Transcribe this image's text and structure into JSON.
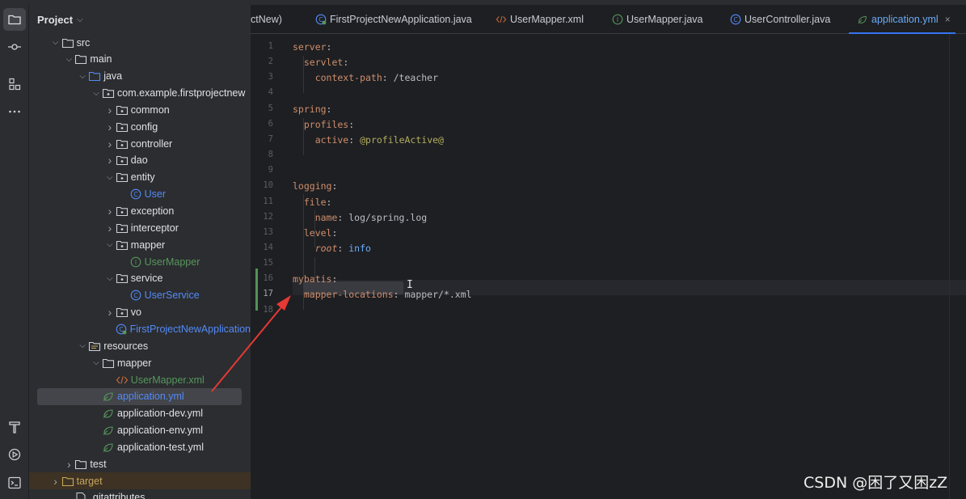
{
  "project_panel": {
    "title": "Project",
    "tree": [
      {
        "label": "src",
        "expanded": true,
        "icon": "folder-icon"
      },
      {
        "label": "main",
        "expanded": true,
        "icon": "folder-icon"
      },
      {
        "label": "java",
        "expanded": true,
        "icon": "source-folder-icon"
      },
      {
        "label": "com.example.firstprojectnew",
        "expanded": true,
        "icon": "package-icon"
      },
      {
        "label": "common",
        "expanded": false,
        "icon": "package-icon"
      },
      {
        "label": "config",
        "expanded": false,
        "icon": "package-icon"
      },
      {
        "label": "controller",
        "expanded": false,
        "icon": "package-icon"
      },
      {
        "label": "dao",
        "expanded": false,
        "icon": "package-icon"
      },
      {
        "label": "entity",
        "expanded": true,
        "icon": "package-icon"
      },
      {
        "label": "User",
        "icon": "class-icon"
      },
      {
        "label": "exception",
        "expanded": false,
        "icon": "package-icon"
      },
      {
        "label": "interceptor",
        "expanded": false,
        "icon": "package-icon"
      },
      {
        "label": "mapper",
        "expanded": true,
        "icon": "package-icon"
      },
      {
        "label": "UserMapper",
        "icon": "interface-icon"
      },
      {
        "label": "service",
        "expanded": true,
        "icon": "package-icon"
      },
      {
        "label": "UserService",
        "icon": "class-icon"
      },
      {
        "label": "vo",
        "expanded": false,
        "icon": "package-icon"
      },
      {
        "label": "FirstProjectNewApplication",
        "icon": "spring-boot-class-icon"
      },
      {
        "label": "resources",
        "expanded": true,
        "icon": "resources-folder-icon"
      },
      {
        "label": "mapper",
        "expanded": true,
        "icon": "folder-icon"
      },
      {
        "label": "UserMapper.xml",
        "icon": "xml-file-icon"
      },
      {
        "label": "application.yml",
        "icon": "yaml-file-icon",
        "selected": true
      },
      {
        "label": "application-dev.yml",
        "icon": "yaml-file-icon"
      },
      {
        "label": "application-env.yml",
        "icon": "yaml-file-icon"
      },
      {
        "label": "application-test.yml",
        "icon": "yaml-file-icon"
      },
      {
        "label": "test",
        "expanded": false,
        "icon": "folder-icon"
      },
      {
        "label": "target",
        "expanded": false,
        "icon": "excluded-folder-icon"
      },
      {
        "label": ".gitattributes",
        "icon": "text-file-icon"
      }
    ]
  },
  "tabs": [
    {
      "label": "ctNew)",
      "icon": ""
    },
    {
      "label": "FirstProjectNewApplication.java",
      "icon": "spring-boot-class-icon"
    },
    {
      "label": "UserMapper.xml",
      "icon": "xml-file-icon"
    },
    {
      "label": "UserMapper.java",
      "icon": "interface-icon"
    },
    {
      "label": "UserController.java",
      "icon": "class-icon"
    },
    {
      "label": "application.yml",
      "icon": "yaml-file-icon",
      "active": true,
      "close": "×"
    }
  ],
  "editor": {
    "current_line": 17,
    "lines": [
      {
        "n": "1",
        "tokens": [
          {
            "t": "server",
            "c": "k"
          },
          {
            "t": ":",
            "c": "v"
          }
        ]
      },
      {
        "n": "2",
        "tokens": [
          {
            "t": "  servlet",
            "c": "k"
          },
          {
            "t": ":",
            "c": "v"
          }
        ]
      },
      {
        "n": "3",
        "tokens": [
          {
            "t": "    context-path",
            "c": "k"
          },
          {
            "t": ": /teacher",
            "c": "v"
          }
        ]
      },
      {
        "n": "4",
        "tokens": []
      },
      {
        "n": "5",
        "tokens": [
          {
            "t": "spring",
            "c": "k"
          },
          {
            "t": ":",
            "c": "v"
          }
        ]
      },
      {
        "n": "6",
        "tokens": [
          {
            "t": "  profiles",
            "c": "k"
          },
          {
            "t": ":",
            "c": "v"
          }
        ]
      },
      {
        "n": "7",
        "tokens": [
          {
            "t": "    active",
            "c": "k"
          },
          {
            "t": ": ",
            "c": "v"
          },
          {
            "t": "@profileActive@",
            "c": "ann"
          }
        ]
      },
      {
        "n": "8",
        "tokens": []
      },
      {
        "n": "9",
        "tokens": []
      },
      {
        "n": "10",
        "tokens": [
          {
            "t": "logging",
            "c": "k"
          },
          {
            "t": ":",
            "c": "v"
          }
        ]
      },
      {
        "n": "11",
        "tokens": [
          {
            "t": "  file",
            "c": "k"
          },
          {
            "t": ":",
            "c": "v"
          }
        ]
      },
      {
        "n": "12",
        "tokens": [
          {
            "t": "    name",
            "c": "k"
          },
          {
            "t": ": log/spring.log",
            "c": "v"
          }
        ]
      },
      {
        "n": "13",
        "tokens": [
          {
            "t": "  level",
            "c": "k"
          },
          {
            "t": ":",
            "c": "v"
          }
        ]
      },
      {
        "n": "14",
        "tokens": [
          {
            "t": "    root",
            "c": "k ital"
          },
          {
            "t": ": ",
            "c": "v"
          },
          {
            "t": "info",
            "c": "blue"
          }
        ]
      },
      {
        "n": "15",
        "tokens": []
      },
      {
        "n": "16",
        "tokens": [
          {
            "t": "mybatis",
            "c": "k"
          },
          {
            "t": ":",
            "c": "v"
          }
        ]
      },
      {
        "n": "17",
        "tokens": [
          {
            "t": "  mapper-locations",
            "c": "k"
          },
          {
            "t": ": mapper/*.xml",
            "c": "v"
          }
        ]
      },
      {
        "n": "18",
        "tokens": []
      }
    ]
  },
  "watermark": "CSDN @困了又困zZ",
  "colors": {
    "accent": "#3574f0",
    "arrow": "#e53935",
    "yaml_key": "#cf8e6d",
    "change_marker": "#549159"
  }
}
